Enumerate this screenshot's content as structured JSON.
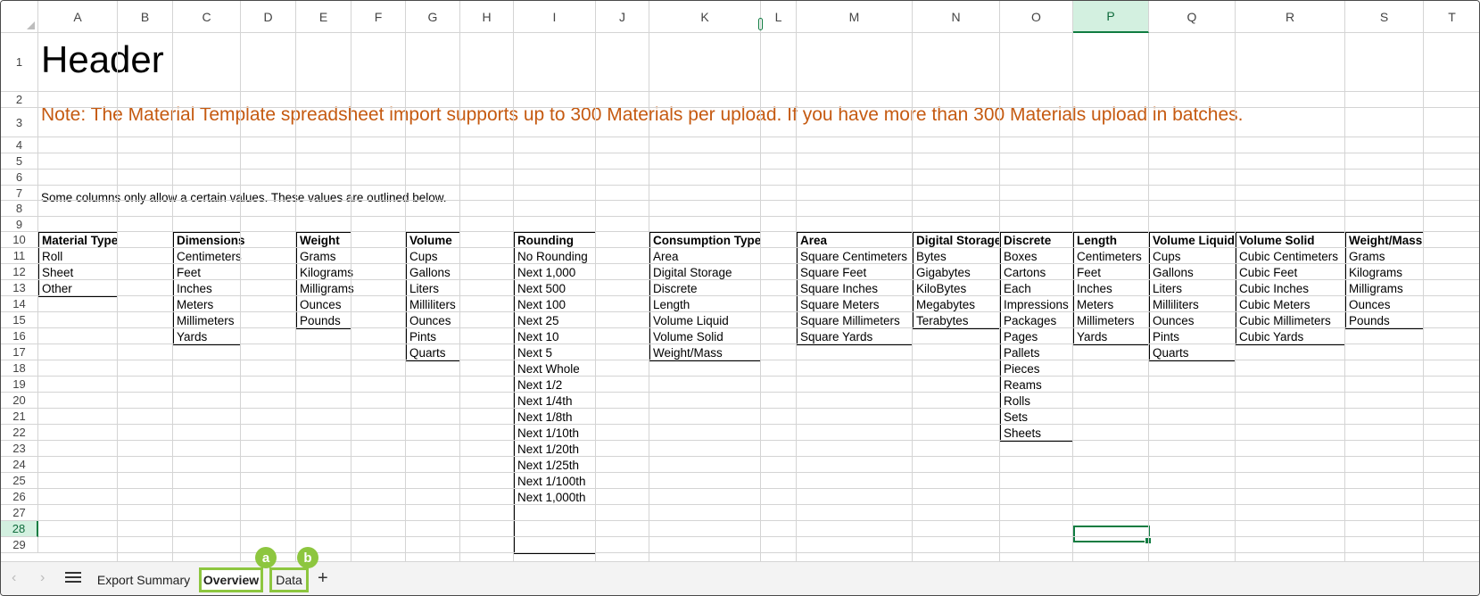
{
  "columns": [
    "A",
    "B",
    "C",
    "D",
    "E",
    "F",
    "G",
    "H",
    "I",
    "J",
    "K",
    "L",
    "M",
    "N",
    "O",
    "P",
    "Q",
    "R",
    "S",
    "T"
  ],
  "rows": [
    "1",
    "2",
    "3",
    "4",
    "5",
    "6",
    "7",
    "8",
    "9",
    "10",
    "11",
    "12",
    "13",
    "14",
    "15",
    "16",
    "17",
    "18",
    "19",
    "20",
    "21",
    "22",
    "23",
    "24",
    "25",
    "26",
    "27",
    "28",
    "29"
  ],
  "selected_column": "P",
  "selected_row": "28",
  "sheet": {
    "header": "Header",
    "note": "Note: The Material Template spreadsheet import supports up to 300 Materials per upload. If you have more than 300 Materials upload in batches.",
    "intro": "Some columns only allow a certain values. These values are outlined below.",
    "lists": [
      {
        "title": "Material Type",
        "items": [
          "Roll",
          "Sheet",
          "Other"
        ]
      },
      {
        "title": "Dimensions",
        "items": [
          "Centimeters",
          "Feet",
          "Inches",
          "Meters",
          "Millimeters",
          "Yards"
        ]
      },
      {
        "title": "Weight",
        "items": [
          "Grams",
          "Kilograms",
          "Milligrams",
          "Ounces",
          "Pounds"
        ]
      },
      {
        "title": "Volume",
        "items": [
          "Cups",
          "Gallons",
          "Liters",
          "Milliliters",
          "Ounces",
          "Pints",
          "Quarts"
        ]
      },
      {
        "title": "Rounding",
        "items": [
          "No Rounding",
          "Next 1,000",
          "Next 500",
          "Next 100",
          "Next 25",
          "Next 10",
          "Next 5",
          "Next Whole",
          "Next 1/2",
          "Next 1/4th",
          "Next 1/8th",
          "Next 1/10th",
          "Next 1/20th",
          "Next 1/25th",
          "Next 1/100th",
          "Next 1,000th",
          "",
          "",
          ""
        ]
      },
      {
        "title": "Consumption Type",
        "items": [
          "Area",
          "Digital Storage",
          "Discrete",
          "Length",
          "Volume Liquid",
          "Volume Solid",
          "Weight/Mass"
        ]
      },
      {
        "title": "Area",
        "items": [
          "Square Centimeters",
          "Square Feet",
          "Square Inches",
          "Square Meters",
          "Square Millimeters",
          "Square Yards"
        ]
      },
      {
        "title": "Digital Storage",
        "items": [
          "Bytes",
          "Gigabytes",
          "KiloBytes",
          "Megabytes",
          "Terabytes"
        ]
      },
      {
        "title": "Discrete",
        "items": [
          "Boxes",
          "Cartons",
          "Each",
          "Impressions",
          "Packages",
          "Pages",
          "Pallets",
          "Pieces",
          "Reams",
          "Rolls",
          "Sets",
          "Sheets"
        ]
      },
      {
        "title": "Length",
        "items": [
          "Centimeters",
          "Feet",
          "Inches",
          "Meters",
          "Millimeters",
          "Yards"
        ]
      },
      {
        "title": "Volume Liquid",
        "items": [
          "Cups",
          "Gallons",
          "Liters",
          "Milliliters",
          "Ounces",
          "Pints",
          "Quarts"
        ]
      },
      {
        "title": "Volume Solid",
        "items": [
          "Cubic Centimeters",
          "Cubic Feet",
          "Cubic Inches",
          "Cubic Meters",
          "Cubic Millimeters",
          "Cubic Yards"
        ]
      },
      {
        "title": "Weight/Mass",
        "items": [
          "Grams",
          "Kilograms",
          "Milligrams",
          "Ounces",
          "Pounds"
        ]
      }
    ]
  },
  "tabs": {
    "export_summary": "Export Summary",
    "overview": "Overview",
    "data": "Data",
    "add": "+",
    "marker_a": "a",
    "marker_b": "b"
  },
  "icons": {
    "prev": "prev-sheet-icon",
    "next": "next-sheet-icon",
    "menu": "sheet-list-icon"
  },
  "colors": {
    "note": "#c55a11",
    "selection": "#107c41",
    "tab_highlight": "#8dc63f"
  }
}
